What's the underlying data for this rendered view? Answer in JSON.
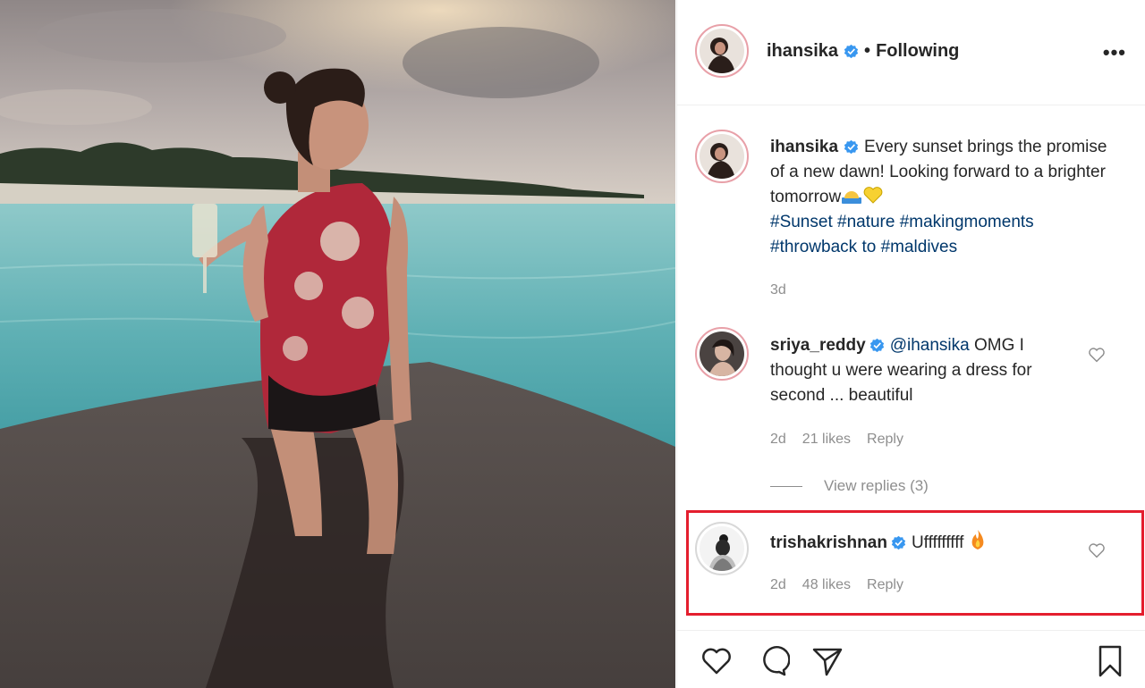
{
  "post": {
    "image_alt": "Woman in a red printed one-shoulder swimsuit holding a glass, seated on a boat deck at sunset with a tropical island behind",
    "author": {
      "username": "ihansika",
      "verified": true,
      "follow_status": "Following",
      "separator": "•"
    },
    "more_options_label": "•••",
    "caption": {
      "username": "ihansika",
      "text": "Every sunset brings the promise of a new dawn! Looking forward to a brighter tomorrow",
      "hashtags": "#Sunset #nature #makingmoments #throwback to #maldives",
      "time": "3d"
    },
    "comments": [
      {
        "username": "sriya_reddy",
        "verified": true,
        "mention": "@ihansika",
        "text": "OMG I thought u were wearing a dress for second ... beautiful",
        "time": "2d",
        "likes": "21 likes",
        "reply_label": "Reply",
        "view_replies": "View replies (3)"
      },
      {
        "username": "trishakrishnan",
        "verified": true,
        "text": "Ufffffffff",
        "time": "2d",
        "likes": "48 likes",
        "reply_label": "Reply",
        "highlighted": true
      }
    ],
    "icons": [
      "like-icon",
      "comment-icon",
      "share-icon",
      "save-icon"
    ]
  },
  "colors": {
    "verified_blue": "#3897f0",
    "highlight_red": "#e41e2e",
    "hashtag_blue": "#00376b",
    "muted_gray": "#8e8e8e"
  }
}
